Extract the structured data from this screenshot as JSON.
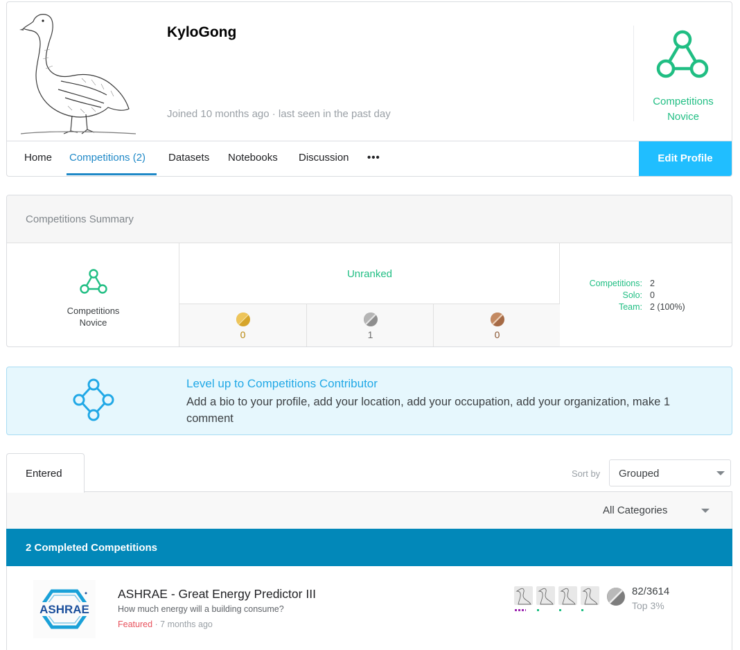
{
  "profile": {
    "username": "KyloGong",
    "joined": "Joined 10 months ago · last seen in the past day",
    "tier_line1": "Competitions",
    "tier_line2": "Novice",
    "tier_color": "#20be83",
    "avatar_icon": "goose-illustration"
  },
  "nav": {
    "tabs": [
      {
        "label": "Home"
      },
      {
        "label": "Competitions (2)",
        "active": true
      },
      {
        "label": "Datasets"
      },
      {
        "label": "Notebooks"
      },
      {
        "label": "Discussion"
      },
      {
        "label": "•••"
      }
    ],
    "edit_label": "Edit Profile",
    "accent": "#1e88c7",
    "edit_color": "#20beff"
  },
  "summary": {
    "title": "Competitions Summary",
    "tier_line1": "Competitions",
    "tier_line2": "Novice",
    "rank": "Unranked",
    "medals": [
      {
        "type": "gold",
        "count": "0",
        "color": "#d6a52a"
      },
      {
        "type": "silver",
        "count": "1",
        "color": "#9e9e9e"
      },
      {
        "type": "bronze",
        "count": "0",
        "color": "#a66a45"
      }
    ],
    "stats": [
      {
        "label": "Competitions:",
        "value": "2"
      },
      {
        "label": "Solo:",
        "value": "0"
      },
      {
        "label": "Team:",
        "value": "2 (100%)"
      }
    ]
  },
  "levelup": {
    "title": "Level up to Competitions Contributor",
    "description": "Add a bio to your profile, add your location, add your occupation, add your organization, make 1 comment",
    "color": "#20a8e6"
  },
  "list": {
    "tab_label": "Entered",
    "sort_label": "Sort by",
    "sort_value": "Grouped",
    "category_value": "All Categories",
    "group_header": "2 Completed Competitions",
    "group_color": "#0288b9",
    "competitions": [
      {
        "logo_text": "ASHRAE",
        "title": "ASHRAE - Great Energy Predictor III",
        "subtitle": "How much energy will a building consume?",
        "tag": "Featured",
        "time": " · 7 months ago",
        "rank": "82/3614",
        "top": "Top 3%",
        "medal": "silver"
      }
    ]
  }
}
